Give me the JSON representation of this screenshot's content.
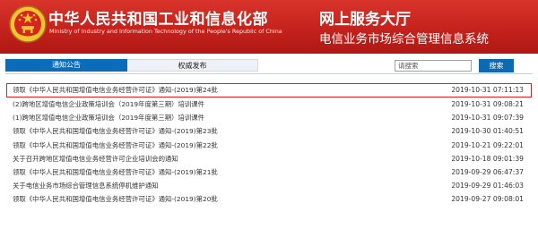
{
  "header": {
    "org_name_cn": "中华人民共和国工业和信息化部",
    "org_name_en": "Ministry of Industry and Information Technology of the People's Republic of China",
    "service_title": "网上服务大厅",
    "service_subtitle": "电信业务市场综合管理信息系统"
  },
  "tabs": [
    {
      "label": "通知公告"
    },
    {
      "label": "权威发布"
    }
  ],
  "search": {
    "placeholder": "请搜索",
    "button_label": "搜索"
  },
  "notices": [
    {
      "title": "领取《中华人民共和国增值电信业务经营许可证》通知-(2019)第24批",
      "date": "2019-10-31 07:11:13"
    },
    {
      "title": "(2)跨地区增值电信企业政策培训会（2019年度第三期）培训课件",
      "date": "2019-10-31 09:08:21"
    },
    {
      "title": "(1)跨地区增值电信企业政策培训会（2019年度第三期）培训课件",
      "date": "2019-10-31 09:07:39"
    },
    {
      "title": "领取《中华人民共和国增值电信业务经营许可证》通知-(2019)第23批",
      "date": "2019-10-30 01:40:51"
    },
    {
      "title": "领取《中华人民共和国增值电信业务经营许可证》通知-(2019)第22批",
      "date": "2019-10-21 09:22:01"
    },
    {
      "title": "关于召开跨地区增值电信业务经营许可企业培训会的通知",
      "date": "2019-10-18 09:01:39"
    },
    {
      "title": "领取《中华人民共和国增值电信业务经营许可证》通知-(2019)第21批",
      "date": "2019-09-29 06:47:37"
    },
    {
      "title": "关于电信业务市场综合管理信息系统停机维护通知",
      "date": "2019-09-29 01:46:03"
    },
    {
      "title": "领取《中华人民共和国增值电信业务经营许可证》通知-(2019)第20批",
      "date": "2019-09-27 09:08:01"
    }
  ],
  "colors": {
    "header_red": "#c4221c",
    "tab_blue": "#0b6cb9",
    "highlight_border": "#e02020"
  }
}
